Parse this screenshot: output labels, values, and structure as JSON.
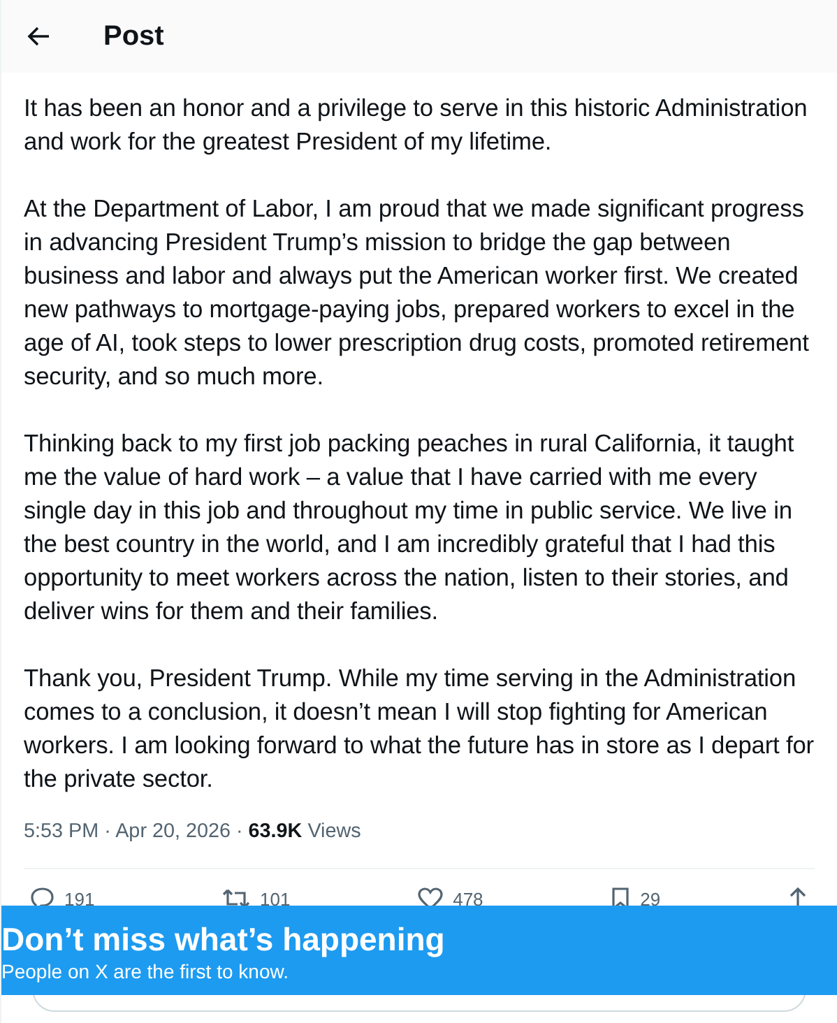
{
  "header": {
    "title": "Post"
  },
  "post": {
    "paragraphs": [
      "It has been an honor and a privilege to serve in this historic Administration and work for the greatest President of my lifetime.",
      "At the Department of Labor, I am proud that we made significant progress in advancing President Trump’s mission to bridge the gap between business and labor and always put the American worker first. We created new pathways to mortgage-paying jobs, prepared workers to excel in the age of AI, took steps to lower prescription drug costs, promoted retirement security, and so much more.",
      "Thinking back to my first job packing peaches in rural California, it taught me the value of hard work – a value that I have carried with me every single day in this job and throughout my time in public service. We live in the best country in the world, and I am incredibly grateful that I had this opportunity to meet workers across the nation, listen to their stories, and deliver wins for them and their families.",
      "Thank you, President Trump. While my time serving in the Administration comes to a conclusion, it doesn’t mean I will stop fighting for American workers. I am looking forward to what the future has in store as I depart for the private sector."
    ],
    "meta": "5:53 PM · Apr 20, 2026 · **63.9K** Views",
    "actions": [
      {
        "kind": "reply",
        "count": "191"
      },
      {
        "kind": "repost",
        "count": "101"
      },
      {
        "kind": "like",
        "count": "478"
      },
      {
        "kind": "bookmark",
        "count": "29"
      },
      {
        "kind": "share"
      }
    ]
  },
  "banner": {
    "title": "Don’t miss what’s happening",
    "subtitle": "People on X are the first to know."
  }
}
